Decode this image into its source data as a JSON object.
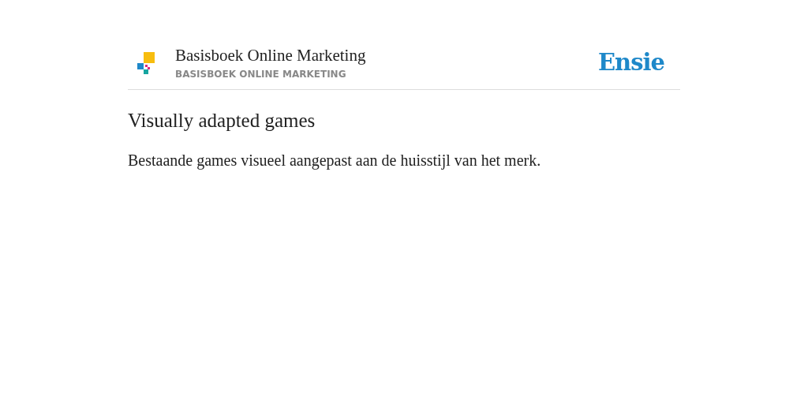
{
  "header": {
    "title": "Basisboek Online Marketing",
    "subtitle": "BASISBOEK ONLINE MARKETING",
    "brand": "Ensie"
  },
  "entry": {
    "heading": "Visually adapted games",
    "definition": "Bestaande games visueel aangepast aan de huisstijl van het merk."
  }
}
